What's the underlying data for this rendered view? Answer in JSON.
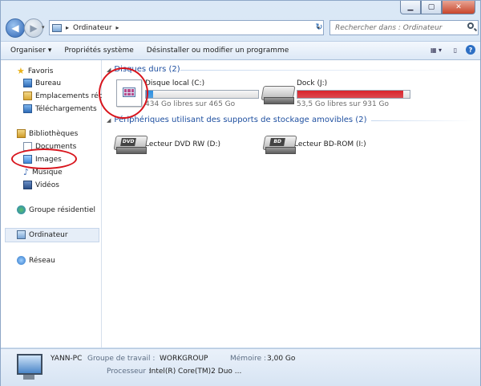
{
  "window": {
    "caption_min": "▁",
    "caption_max": "▢",
    "caption_close": "✕"
  },
  "nav": {
    "back": "◀",
    "forward": "▶",
    "dropdown": "▾"
  },
  "address": {
    "location": "Ordinateur",
    "sep1": "▸",
    "sep2": "▸",
    "dropdown": "▾",
    "refresh": "↻"
  },
  "search": {
    "placeholder": "Rechercher dans : Ordinateur"
  },
  "toolbar": {
    "organize": "Organiser ▾",
    "properties": "Propriétés système",
    "uninstall": "Désinstaller ou modifier un programme",
    "view_icon": "▦ ▾",
    "pane_icon": "▯",
    "help": "?"
  },
  "sidebar": {
    "favorites": {
      "label": "Favoris",
      "items": [
        {
          "label": "Bureau"
        },
        {
          "label": "Emplacements réce"
        },
        {
          "label": "Téléchargements"
        }
      ]
    },
    "libraries": {
      "label": "Bibliothèques",
      "items": [
        {
          "label": "Documents"
        },
        {
          "label": "Images"
        },
        {
          "label": "Musique"
        },
        {
          "label": "Vidéos"
        }
      ]
    },
    "homegroup": "Groupe résidentiel",
    "computer": "Ordinateur",
    "network": "Réseau"
  },
  "groups": {
    "hard_disks": "Disques durs (2)",
    "removable": "Périphériques utilisant des supports de stockage amovibles (2)"
  },
  "drives": [
    {
      "name": "Disque local (C:)",
      "free": "434 Go libres sur 465 Go",
      "used_fraction": 0.067,
      "fill_color": "#2b8fe0"
    },
    {
      "name": "Dock (J:)",
      "free": "53,5 Go libres sur 931 Go",
      "used_fraction": 0.94,
      "fill_color": "#d9232b"
    }
  ],
  "removable": [
    {
      "name": "Lecteur DVD RW (D:)",
      "badge": "DVD"
    },
    {
      "name": "Lecteur BD-ROM (I:)",
      "badge": "BD"
    }
  ],
  "details": {
    "pc_name": "YANN-PC",
    "workgroup_label": "Groupe de travail :",
    "workgroup": "WORKGROUP",
    "memory_label": "Mémoire :",
    "memory": "3,00 Go",
    "processor_label": "Processeur :",
    "processor": "Intel(R) Core(TM)2 Duo ..."
  },
  "colors": {
    "annotation_red": "#d8141c",
    "link_blue": "#1e4fa0"
  }
}
